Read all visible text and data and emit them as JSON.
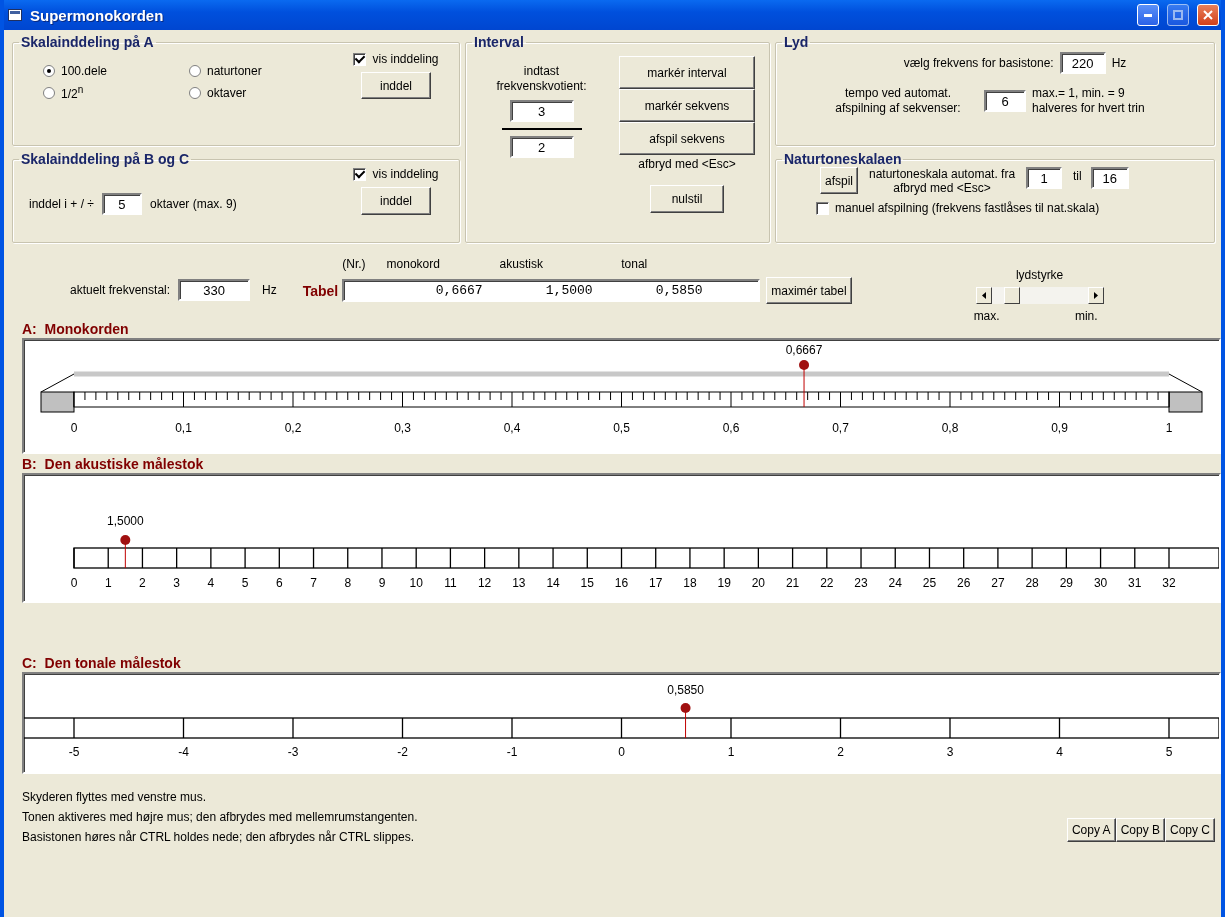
{
  "window": {
    "title": "Supermonokorden"
  },
  "scale_a_settings": {
    "title": "Skalainddeling på A",
    "options": [
      {
        "label": "100.dele",
        "selected": true
      },
      {
        "label": "naturtoner",
        "selected": false
      },
      {
        "label": "1/2$^{n}$",
        "selected": false
      },
      {
        "label": "oktaver",
        "selected": false
      }
    ],
    "show_division": {
      "label": "vis inddeling",
      "checked": true
    },
    "button": "inddel"
  },
  "scale_bc_settings": {
    "title": "Skalainddeling på B og C",
    "show_division": {
      "label": "vis inddeling",
      "checked": true
    },
    "prefix": "inddel i + / ÷",
    "value": "5",
    "suffix": "oktaver (max. 9)",
    "button": "inddel"
  },
  "interval": {
    "title": "Interval",
    "prompt": "indtast frekvenskvotient:",
    "numerator": "3",
    "denominator": "2",
    "buttons": [
      "markér interval",
      "markér sekvens",
      "afspil sekvens"
    ],
    "hint": "afbryd med <Esc>",
    "reset_button": "nulstil"
  },
  "sound": {
    "title": "Lyd",
    "base_label": "vælg frekvens for basistone:",
    "base_value": "220",
    "base_unit": "Hz",
    "tempo_label": "tempo ved automat. afspilning af sekvenser:",
    "tempo_value": "6",
    "tempo_notes": [
      "max.= 1, min. = 9",
      "halveres for hvert trin"
    ]
  },
  "natural_scale": {
    "title": "Naturtoneskalaen",
    "play_button": "afspil",
    "label": "naturtoneskala automat. fra",
    "from": "1",
    "to_label": "til",
    "to": "16",
    "hint": "afbryd med <Esc>",
    "manual": {
      "label": "manuel afspilning (frekvens fastlåses til nat.skala)",
      "checked": false
    }
  },
  "current": {
    "label": "aktuelt frekvenstal:",
    "value": "330",
    "unit": "Hz"
  },
  "table": {
    "title": "Tabel",
    "columns": [
      "(Nr.)",
      "monokord",
      "akustisk",
      "tonal"
    ],
    "values": [
      "0,6667",
      "1,5000",
      "0,5850"
    ],
    "button": "maximér tabel"
  },
  "volume": {
    "label": "lydstyrke",
    "level": 0.15,
    "left_label": "max.",
    "right_label": "min."
  },
  "scales": [
    {
      "kind": "monochord",
      "title": "A:  Monokorden",
      "ticks": [
        "0",
        "0,1",
        "0,2",
        "0,3",
        "0,4",
        "0,5",
        "0,6",
        "0,7",
        "0,8",
        "0,9",
        "1"
      ],
      "marker": {
        "label": "0,6667",
        "level": 0.6667
      }
    },
    {
      "kind": "acoustic",
      "title": "B:  Den akustiske målestok",
      "ticks": [
        "0",
        "1",
        "2",
        "3",
        "4",
        "5",
        "6",
        "7",
        "8",
        "9",
        "10",
        "11",
        "12",
        "13",
        "14",
        "15",
        "16",
        "17",
        "18",
        "19",
        "20",
        "21",
        "22",
        "23",
        "24",
        "25",
        "26",
        "27",
        "28",
        "29",
        "30",
        "31",
        "32"
      ],
      "marker": {
        "label": "1,5000",
        "level": 0.046875
      }
    },
    {
      "kind": "tonal",
      "title": "C:  Den tonale målestok",
      "ticks": [
        "-5",
        "-4",
        "-3",
        "-2",
        "-1",
        "0",
        "1",
        "2",
        "3",
        "4",
        "5"
      ],
      "marker": {
        "label": "0,5850",
        "level": 0.5585
      }
    }
  ],
  "instructions": [
    "Skyderen flyttes med venstre mus.",
    "Tonen aktiveres med højre mus; den afbrydes med mellemrumstangenten.",
    "Basistonen høres når CTRL holdes nede; den afbrydes når CTRL slippes."
  ],
  "copy_buttons": [
    "Copy A",
    "Copy B",
    "Copy C"
  ]
}
